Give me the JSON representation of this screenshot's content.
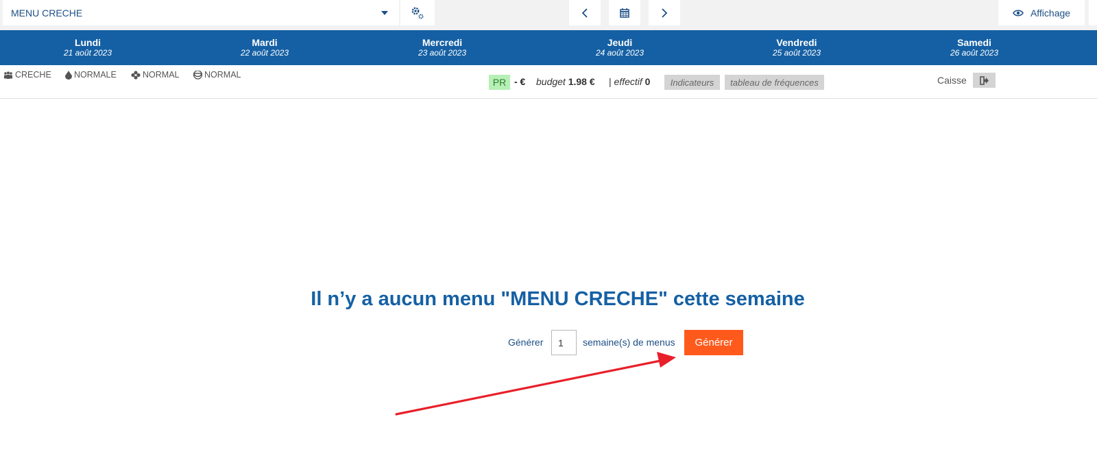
{
  "toolbar": {
    "menu_select": "MENU CRECHE",
    "view_label": "Affichage"
  },
  "days": [
    {
      "name": "Lundi",
      "date": "21 août 2023"
    },
    {
      "name": "Mardi",
      "date": "22 août 2023"
    },
    {
      "name": "Mercredi",
      "date": "23 août 2023"
    },
    {
      "name": "Jeudi",
      "date": "24 août 2023"
    },
    {
      "name": "Vendredi",
      "date": "25 août 2023"
    },
    {
      "name": "Samedi",
      "date": "26 août 2023"
    }
  ],
  "info": {
    "tags": [
      {
        "icon": "group-icon",
        "label": "CRECHE"
      },
      {
        "icon": "drop-icon",
        "label": "NORMALE"
      },
      {
        "icon": "flower-icon",
        "label": "NORMAL"
      },
      {
        "icon": "bowl-icon",
        "label": "NORMAL"
      }
    ],
    "pr_badge": "PR",
    "cost": "- €",
    "budget_label": "budget",
    "budget_value": "1.98 €",
    "effectif_label": "effectif",
    "effectif_value": "0",
    "indicateurs_label": "Indicateurs",
    "frequences_label": "tableau de fréquences",
    "caisse_label": "Caisse"
  },
  "main": {
    "empty_title": "Il n’y a aucun menu \"MENU CRECHE\" cette semaine",
    "generate_prefix": "Générer",
    "weeks_value": "1",
    "generate_suffix": "semaine(s) de menus",
    "generate_button": "Générer"
  },
  "colors": {
    "header_blue": "#1560a4",
    "accent_orange": "#ff5a1c",
    "annotation_red": "#e8202a"
  }
}
